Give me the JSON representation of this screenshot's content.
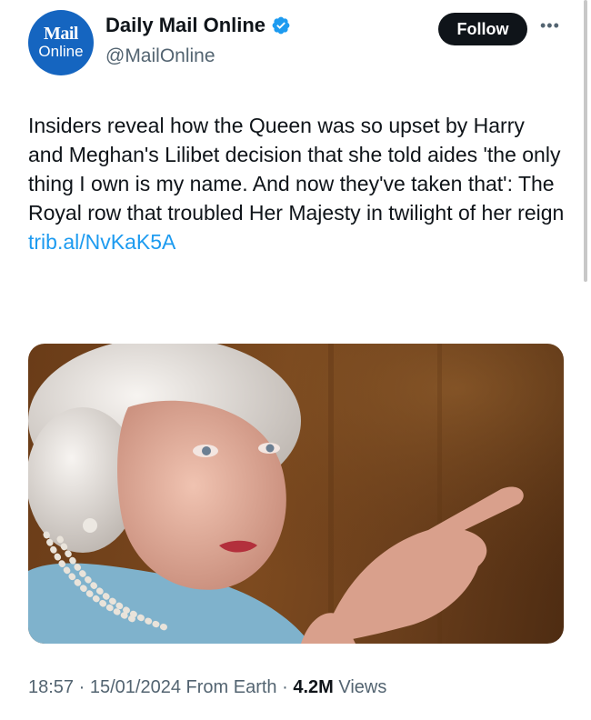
{
  "author": {
    "avatar_line1": "Mail",
    "avatar_line2": "Online",
    "display_name": "Daily Mail Online",
    "handle": "@MailOnline",
    "verified": true
  },
  "follow_label": "Follow",
  "more_icon": "more-horizontal-icon",
  "tweet": {
    "text": "Insiders reveal how the Queen was so upset by Harry and Meghan's Lilibet decision that she told aides 'the only thing I own is my name. And now they've taken that': The Royal row that troubled Her Majesty in twilight of her reign",
    "link": "trib.al/NvKaK5A"
  },
  "meta": {
    "time": "18:57",
    "date": "15/01/2024",
    "source": "From Earth",
    "views_count": "4.2M",
    "views_label": "Views"
  },
  "colors": {
    "link": "#1d9bf0",
    "verified": "#1d9bf0",
    "avatar": "#1565c0",
    "button": "#0f1419",
    "secondary_text": "#536471"
  }
}
